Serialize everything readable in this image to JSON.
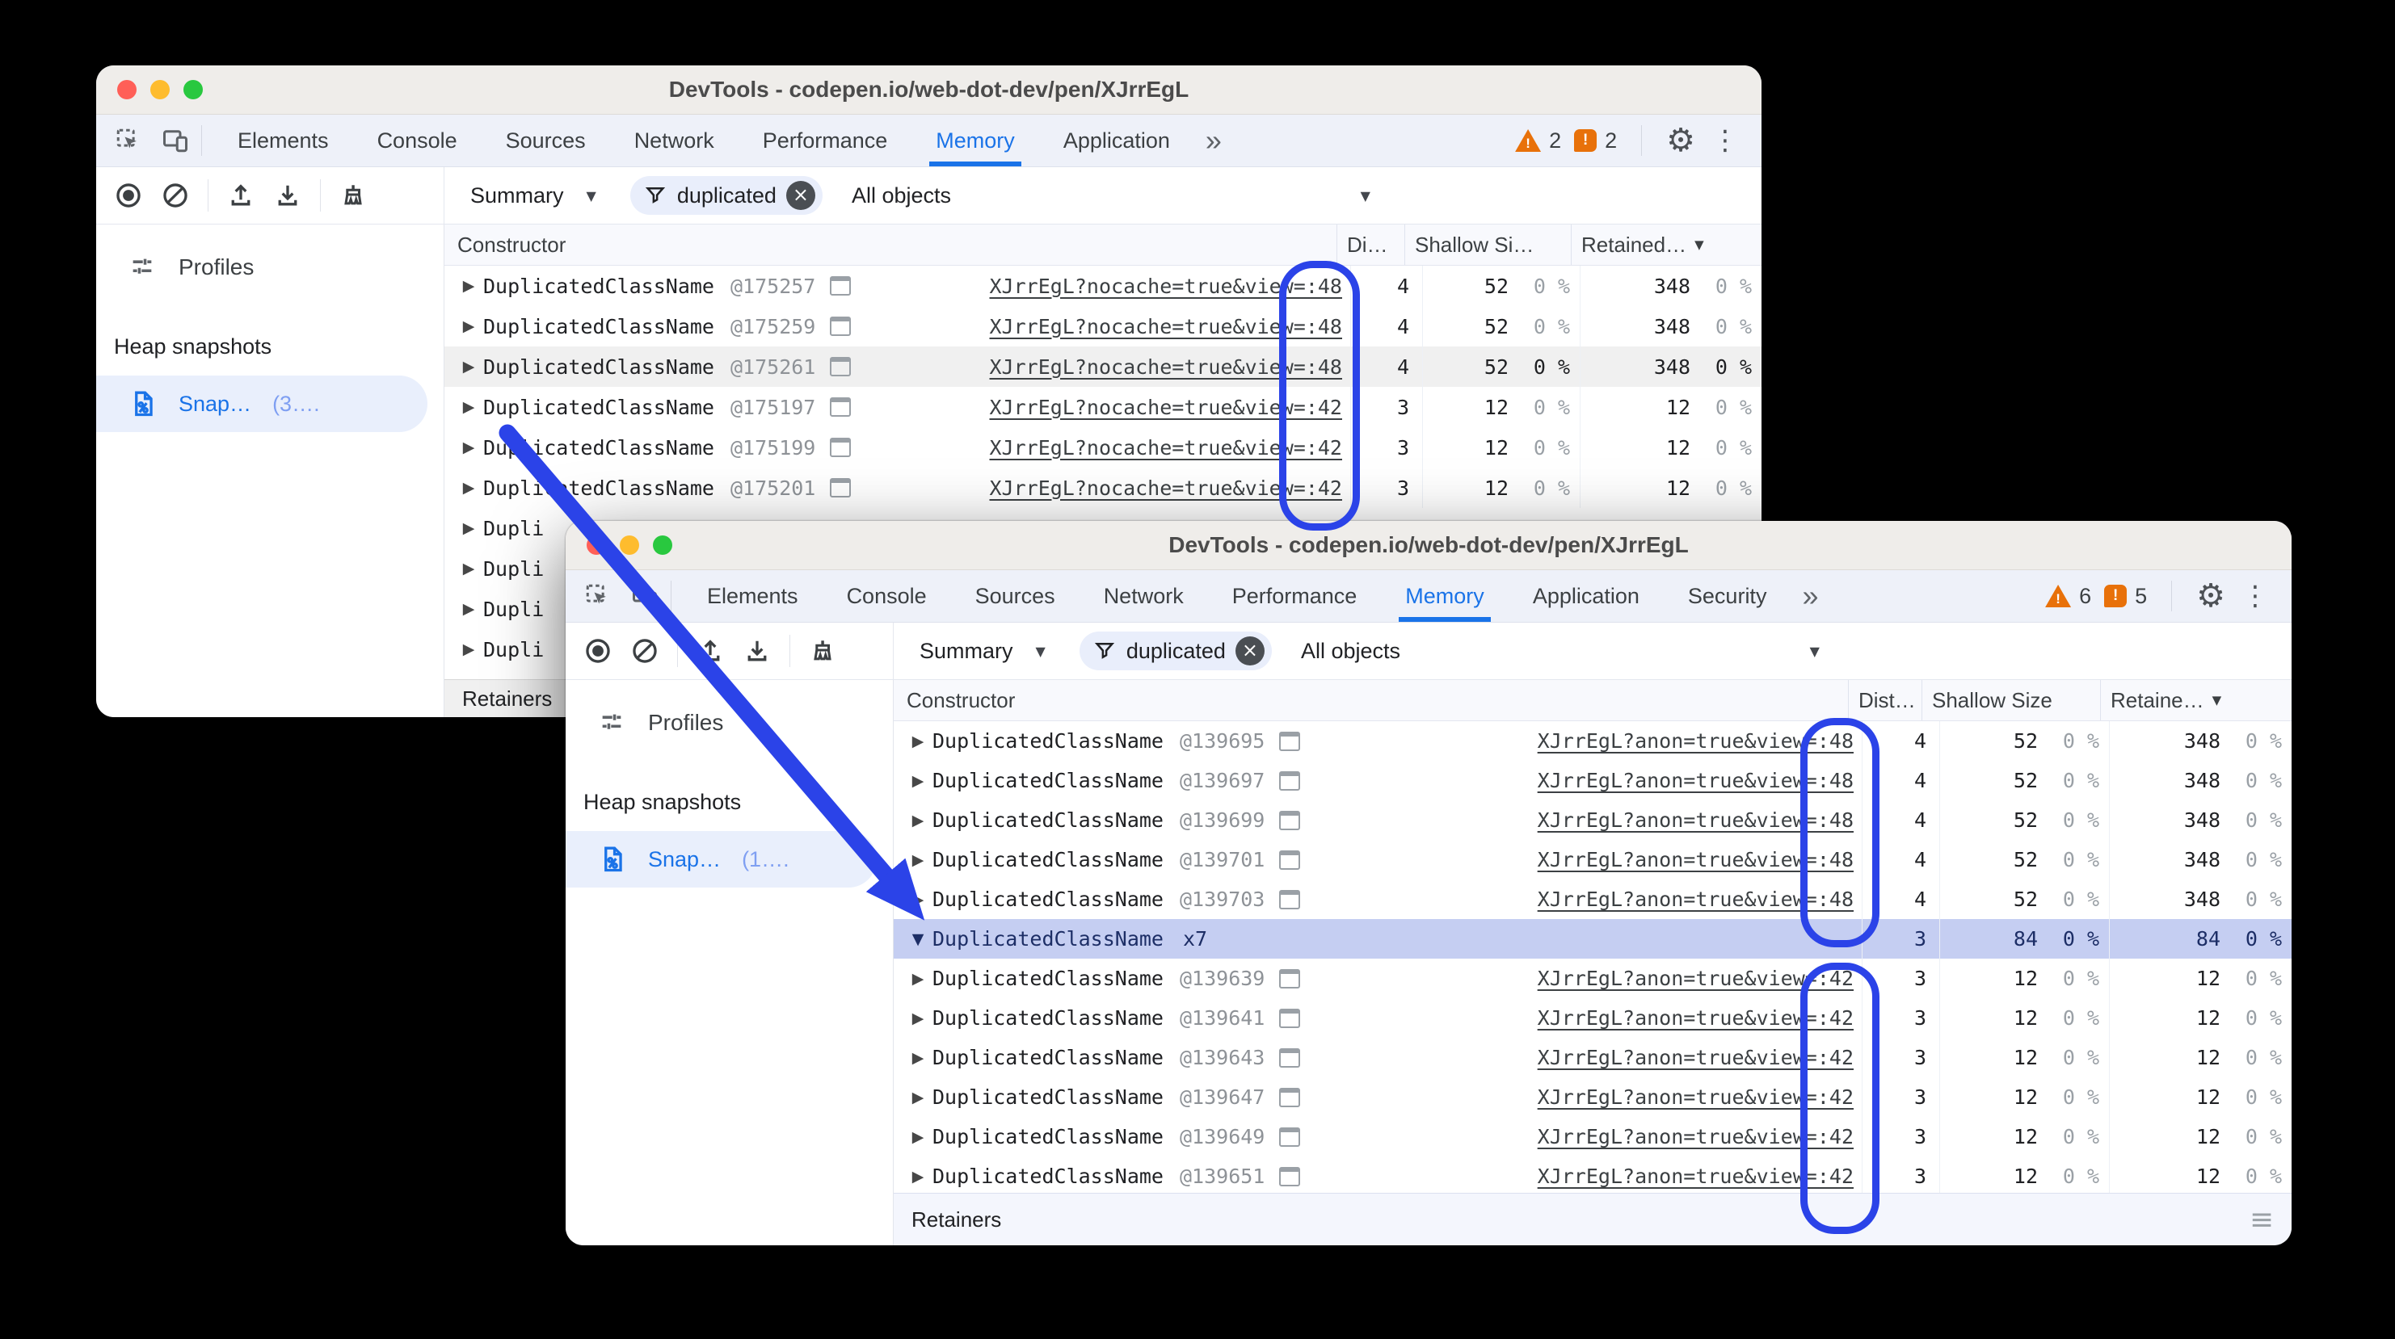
{
  "annotation_color": "#2b43e8",
  "accent_blue": "#1a73e8",
  "win1": {
    "title": "DevTools - codepen.io/web-dot-dev/pen/XJrrEgL",
    "tabs": [
      "Elements",
      "Console",
      "Sources",
      "Network",
      "Performance",
      "Memory",
      "Application"
    ],
    "active_tab": "Memory",
    "badges": {
      "warnings": "2",
      "issues": "2"
    },
    "toolbar": {
      "summary": "Summary",
      "filter": "duplicated",
      "objects": "All objects"
    },
    "sidebar": {
      "profiles": "Profiles",
      "heap_heading": "Heap snapshots",
      "snapshot": "Snap…",
      "snapshot_count": "(3…."
    },
    "table": {
      "col_constructor": "Constructor",
      "col_distance": "Di…",
      "col_shallow": "Shallow Si…",
      "col_retained": "Retained…",
      "retainers": "Retainers",
      "rows": [
        {
          "kind": "item",
          "name": "DuplicatedClassName",
          "id": "@175257",
          "url": "XJrrEgL?nocache=true&view=:48",
          "dist": "4",
          "shallow": "52",
          "shallow_pct": "0 %",
          "retained": "348",
          "retained_pct": "0 %",
          "state": ""
        },
        {
          "kind": "item",
          "name": "DuplicatedClassName",
          "id": "@175259",
          "url": "XJrrEgL?nocache=true&view=:48",
          "dist": "4",
          "shallow": "52",
          "shallow_pct": "0 %",
          "retained": "348",
          "retained_pct": "0 %",
          "state": ""
        },
        {
          "kind": "item",
          "name": "DuplicatedClassName",
          "id": "@175261",
          "url": "XJrrEgL?nocache=true&view=:48",
          "dist": "4",
          "shallow": "52",
          "shallow_pct": "0 %",
          "retained": "348",
          "retained_pct": "0 %",
          "state": "hl"
        },
        {
          "kind": "item",
          "name": "DuplicatedClassName",
          "id": "@175197",
          "url": "XJrrEgL?nocache=true&view=:42",
          "dist": "3",
          "shallow": "12",
          "shallow_pct": "0 %",
          "retained": "12",
          "retained_pct": "0 %",
          "state": ""
        },
        {
          "kind": "item",
          "name": "DuplicatedClassName",
          "id": "@175199",
          "url": "XJrrEgL?nocache=true&view=:42",
          "dist": "3",
          "shallow": "12",
          "shallow_pct": "0 %",
          "retained": "12",
          "retained_pct": "0 %",
          "state": ""
        },
        {
          "kind": "item",
          "name": "DuplicatedClassName",
          "id": "@175201",
          "url": "XJrrEgL?nocache=true&view=:42",
          "dist": "3",
          "shallow": "12",
          "shallow_pct": "0 %",
          "retained": "12",
          "retained_pct": "0 %",
          "state": ""
        },
        {
          "kind": "stub",
          "name": "Dupli"
        },
        {
          "kind": "stub",
          "name": "Dupli"
        },
        {
          "kind": "stub",
          "name": "Dupli"
        },
        {
          "kind": "stub",
          "name": "Dupli"
        }
      ]
    }
  },
  "win2": {
    "title": "DevTools - codepen.io/web-dot-dev/pen/XJrrEgL",
    "tabs": [
      "Elements",
      "Console",
      "Sources",
      "Network",
      "Performance",
      "Memory",
      "Application",
      "Security"
    ],
    "active_tab": "Memory",
    "badges": {
      "warnings": "6",
      "issues": "5"
    },
    "toolbar": {
      "summary": "Summary",
      "filter": "duplicated",
      "objects": "All objects"
    },
    "sidebar": {
      "profiles": "Profiles",
      "heap_heading": "Heap snapshots",
      "snapshot": "Snap…",
      "snapshot_count": "(1…."
    },
    "table": {
      "col_constructor": "Constructor",
      "col_distance": "Dist…",
      "col_shallow": "Shallow Size",
      "col_retained": "Retaine…",
      "retainers": "Retainers",
      "rows": [
        {
          "kind": "item",
          "name": "DuplicatedClassName",
          "id": "@139695",
          "url": "XJrrEgL?anon=true&view=:48",
          "dist": "4",
          "shallow": "52",
          "shallow_pct": "0 %",
          "retained": "348",
          "retained_pct": "0 %",
          "state": ""
        },
        {
          "kind": "item",
          "name": "DuplicatedClassName",
          "id": "@139697",
          "url": "XJrrEgL?anon=true&view=:48",
          "dist": "4",
          "shallow": "52",
          "shallow_pct": "0 %",
          "retained": "348",
          "retained_pct": "0 %",
          "state": ""
        },
        {
          "kind": "item",
          "name": "DuplicatedClassName",
          "id": "@139699",
          "url": "XJrrEgL?anon=true&view=:48",
          "dist": "4",
          "shallow": "52",
          "shallow_pct": "0 %",
          "retained": "348",
          "retained_pct": "0 %",
          "state": ""
        },
        {
          "kind": "item",
          "name": "DuplicatedClassName",
          "id": "@139701",
          "url": "XJrrEgL?anon=true&view=:48",
          "dist": "4",
          "shallow": "52",
          "shallow_pct": "0 %",
          "retained": "348",
          "retained_pct": "0 %",
          "state": ""
        },
        {
          "kind": "item",
          "name": "DuplicatedClassName",
          "id": "@139703",
          "url": "XJrrEgL?anon=true&view=:48",
          "dist": "4",
          "shallow": "52",
          "shallow_pct": "0 %",
          "retained": "348",
          "retained_pct": "0 %",
          "state": ""
        },
        {
          "kind": "group",
          "name": "DuplicatedClassName",
          "count": "x7",
          "dist": "3",
          "shallow": "84",
          "shallow_pct": "0 %",
          "retained": "84",
          "retained_pct": "0 %",
          "state": "sel"
        },
        {
          "kind": "item",
          "name": "DuplicatedClassName",
          "id": "@139639",
          "url": "XJrrEgL?anon=true&view=:42",
          "dist": "3",
          "shallow": "12",
          "shallow_pct": "0 %",
          "retained": "12",
          "retained_pct": "0 %",
          "state": ""
        },
        {
          "kind": "item",
          "name": "DuplicatedClassName",
          "id": "@139641",
          "url": "XJrrEgL?anon=true&view=:42",
          "dist": "3",
          "shallow": "12",
          "shallow_pct": "0 %",
          "retained": "12",
          "retained_pct": "0 %",
          "state": ""
        },
        {
          "kind": "item",
          "name": "DuplicatedClassName",
          "id": "@139643",
          "url": "XJrrEgL?anon=true&view=:42",
          "dist": "3",
          "shallow": "12",
          "shallow_pct": "0 %",
          "retained": "12",
          "retained_pct": "0 %",
          "state": ""
        },
        {
          "kind": "item",
          "name": "DuplicatedClassName",
          "id": "@139647",
          "url": "XJrrEgL?anon=true&view=:42",
          "dist": "3",
          "shallow": "12",
          "shallow_pct": "0 %",
          "retained": "12",
          "retained_pct": "0 %",
          "state": ""
        },
        {
          "kind": "item",
          "name": "DuplicatedClassName",
          "id": "@139649",
          "url": "XJrrEgL?anon=true&view=:42",
          "dist": "3",
          "shallow": "12",
          "shallow_pct": "0 %",
          "retained": "12",
          "retained_pct": "0 %",
          "state": ""
        },
        {
          "kind": "item",
          "name": "DuplicatedClassName",
          "id": "@139651",
          "url": "XJrrEgL?anon=true&view=:42",
          "dist": "3",
          "shallow": "12",
          "shallow_pct": "0 %",
          "retained": "12",
          "retained_pct": "0 %",
          "state": ""
        }
      ]
    }
  }
}
